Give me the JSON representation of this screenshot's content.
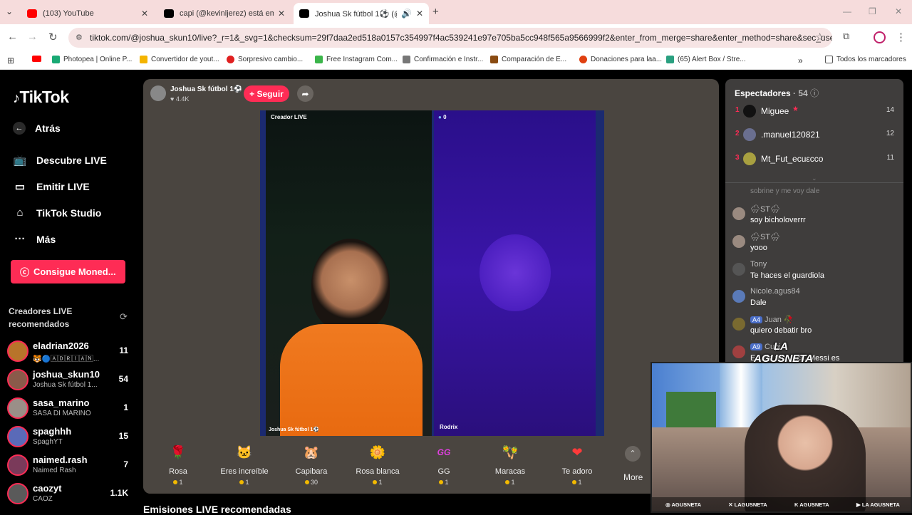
{
  "tabs": [
    {
      "title": "(103) YouTube",
      "icon": "youtube-icon",
      "color": "#ff0000"
    },
    {
      "title": "capi (@kevinljerez) está emitien",
      "icon": "tiktok-icon",
      "color": "#000000"
    },
    {
      "title": "Joshua Sk fútbol 1⚽ (@jos",
      "icon": "tiktok-icon",
      "color": "#000000",
      "active": true
    }
  ],
  "url": "tiktok.com/@joshua_skun10/live?_r=1&_svg=1&checksum=29f7daa2ed518a0157c354997f4ac539241e97e705ba5cc948f565a9566999f2&enter_from_merge=share&enter_method=share&sec_user_id=M...",
  "bookmarks": [
    {
      "label": "Photopea | Online P...",
      "color": "#19a974"
    },
    {
      "label": "Convertidor de yout...",
      "color": "#f4b400"
    },
    {
      "label": "Sorpresivo cambio...",
      "color": "#e02020"
    },
    {
      "label": "Free Instagram Com...",
      "color": "#3bb54a"
    },
    {
      "label": "Confirmación e Instr...",
      "color": "#777777"
    },
    {
      "label": "Comparación de E...",
      "color": "#8a4b12"
    },
    {
      "label": "Donaciones para laa...",
      "color": "#e04010"
    },
    {
      "label": "(65) Alert Box / Stre...",
      "color": "#2aa080"
    }
  ],
  "all_bookmarks": "Todos los marcadores",
  "brand": "TikTok",
  "nav": {
    "back": "Atrás",
    "discover": "Descubre LIVE",
    "go_live": "Emitir LIVE",
    "studio": "TikTok Studio",
    "more": "Más"
  },
  "coins_button": "Consigue Moned...",
  "recommended_title": "Creadores LIVE recomendados",
  "creators": [
    {
      "name": "eladrian2026",
      "sub": "🐯🔵🄰🄳🅁🄸🄰🄽...",
      "count": "11",
      "color": "#b8742a"
    },
    {
      "name": "joshua_skun10",
      "sub": "Joshua Sk fútbol 1...",
      "count": "54",
      "color": "#8a5a4a"
    },
    {
      "name": "sasa_marino",
      "sub": "SASA DI MARINO",
      "count": "1",
      "color": "#9a8f88"
    },
    {
      "name": "spaghhh",
      "sub": "SpaghYT",
      "count": "15",
      "color": "#5a6ab8"
    },
    {
      "name": "naimed.rash",
      "sub": "Naimed Rash",
      "count": "7",
      "color": "#7a3a5a"
    },
    {
      "name": "caozyt",
      "sub": "CAOZ",
      "count": "1.1K",
      "color": "#5a5a5a"
    }
  ],
  "host": {
    "name": "Joshua Sk fútbol 1⚽",
    "likes": "4.4K",
    "follow": "+ Seguir"
  },
  "video": {
    "creator_tag": "Creador LIVE",
    "left_name": "Joshua Sk fútbol 1⚽",
    "right_name": "Rodrix",
    "right_score": "0"
  },
  "gifts": [
    {
      "name": "Rosa",
      "price": "1",
      "icon": "rose-icon",
      "glyph": "🌹"
    },
    {
      "name": "Eres increíble",
      "price": "1",
      "icon": "cat-icon",
      "glyph": "🐱"
    },
    {
      "name": "Capibara",
      "price": "30",
      "icon": "capybara-icon",
      "glyph": "🐹"
    },
    {
      "name": "Rosa blanca",
      "price": "1",
      "icon": "white-rose-icon",
      "glyph": "🌼"
    },
    {
      "name": "GG",
      "price": "1",
      "icon": "gg-icon",
      "glyph": "GG"
    },
    {
      "name": "Maracas",
      "price": "1",
      "icon": "maracas-icon",
      "glyph": "🪇"
    },
    {
      "name": "Te adoro",
      "price": "1",
      "icon": "heart-icon",
      "glyph": "❤"
    }
  ],
  "more_label": "More",
  "recommended_streams": "Emisiones LIVE recomendadas",
  "viewers": {
    "label": "Espectadores",
    "count": "· 54"
  },
  "top_viewers": [
    {
      "rank": "1",
      "name": "Miguee",
      "count": "14",
      "color": "#111111"
    },
    {
      "rank": "2",
      "name": ".manuel120821",
      "count": "12",
      "color": "#6a6f90"
    },
    {
      "rank": "3",
      "name": "Mt_Fut_ecuεcco",
      "count": "11",
      "color": "#a8a040"
    }
  ],
  "chat_partial": "sobrine y me voy dale",
  "messages": [
    {
      "user": "🌧ST🌧",
      "text": "soy bicholoverrr",
      "color": "#9a8a80",
      "badge": ""
    },
    {
      "user": "🌧ST🌧",
      "text": "yooo",
      "color": "#9a8a80",
      "badge": ""
    },
    {
      "user": "Tony",
      "text": "Te haces el guardiola",
      "color": "#555555",
      "badge": ""
    },
    {
      "user": "Nicole.agus84",
      "text": "Dale",
      "color": "#5a7ab8",
      "badge": ""
    },
    {
      "user": "Juan 🥀",
      "text": "quiero debatir bro",
      "color": "#7a6a30",
      "badge": "A4"
    },
    {
      "user": "Cupi",
      "text": "E... de tiro, fácil, Messi es",
      "color": "#a04040",
      "badge": "A9"
    }
  ],
  "overlay": {
    "logo": "LA AGUSNETA",
    "socials": [
      "AGUSNETA",
      "LAGUSNETA",
      "AGUSNETA",
      "LA AGUSNETA"
    ]
  }
}
